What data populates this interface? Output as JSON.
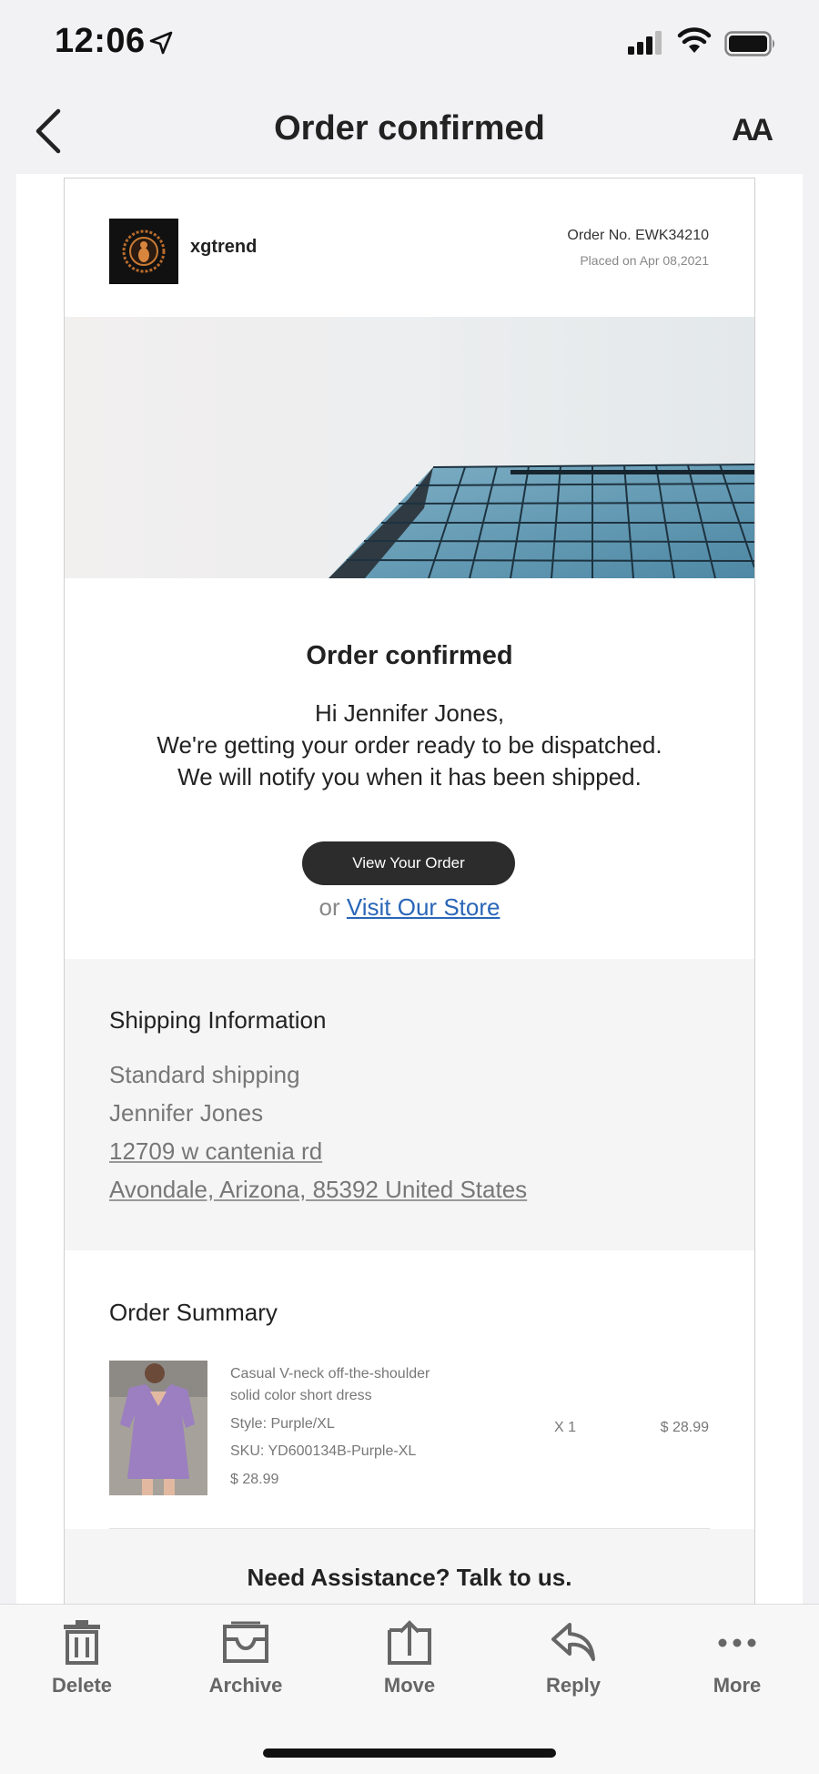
{
  "status_bar": {
    "time": "12:06"
  },
  "nav": {
    "title": "Order confirmed",
    "text_size_label": "AA"
  },
  "email": {
    "brand_name": "xgtrend",
    "order_no": "Order No. EWK34210",
    "placed_on": "Placed on Apr 08,2021",
    "heading": "Order confirmed",
    "greeting": "Hi Jennifer Jones,",
    "message_line1": "We're getting your order ready to be dispatched.",
    "message_line2": "We will notify you when it has been shipped.",
    "view_order_label": "View Your Order",
    "or_text": "or",
    "visit_store_label": "Visit Our Store",
    "shipping": {
      "title": "Shipping Information",
      "method": "Standard shipping",
      "name": "Jennifer Jones",
      "street": "12709 w cantenia rd",
      "city_line": "Avondale, Arizona, 85392 United States"
    },
    "summary": {
      "title": "Order Summary",
      "item": {
        "name_line1": "Casual V-neck off-the-shoulder",
        "name_line2": "solid color short dress",
        "style": "Style: Purple/XL",
        "sku": "SKU: YD600134B-Purple-XL",
        "unit_price": "$ 28.99",
        "quantity": "X 1",
        "total": "$ 28.99"
      }
    },
    "assistance": "Need Assistance? Talk to us."
  },
  "toolbar": {
    "delete": "Delete",
    "archive": "Archive",
    "move": "Move",
    "reply": "Reply",
    "more": "More"
  },
  "colors": {
    "link": "#2a66b8",
    "button": "#2c2c2c",
    "product": "#9b7fc0"
  }
}
